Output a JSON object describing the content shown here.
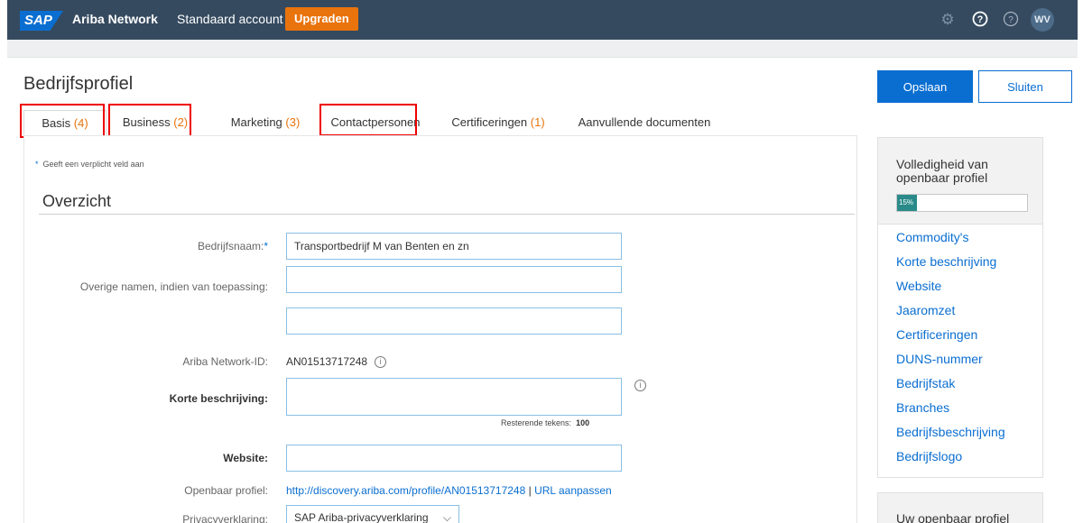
{
  "topbar": {
    "logo": "SAP",
    "brand": "Ariba Network",
    "account": "Standaard account",
    "upgrade_label": "Upgraden",
    "avatar_initials": "WV",
    "icons": [
      "gear-icon",
      "help-icon",
      "help-outline-icon"
    ]
  },
  "page": {
    "title": "Bedrijfsprofiel",
    "save_label": "Opslaan",
    "close_label": "Sluiten"
  },
  "tabs": [
    {
      "label": "Basis",
      "count": "(4)"
    },
    {
      "label": "Business",
      "count": "(2)"
    },
    {
      "label": "Marketing",
      "count": "(3)"
    },
    {
      "label": "Contactpersonen",
      "count": ""
    },
    {
      "label": "Certificeringen",
      "count": "(1)"
    },
    {
      "label": "Aanvullende documenten",
      "count": ""
    }
  ],
  "form": {
    "required_note": "Geeft een verplicht veld aan",
    "section_title": "Overzicht",
    "company_name_label": "Bedrijfsnaam:",
    "company_name_value": "Transportbedrijf M van Benten en zn",
    "other_names_label": "Overige namen, indien van toepassing:",
    "other_names_value_1": "",
    "other_names_value_2": "",
    "network_id_label": "Ariba Network-ID:",
    "network_id_value": "AN01513717248",
    "short_desc_label": "Korte beschrijving:",
    "short_desc_value": "",
    "remaining_label": "Resterende tekens:",
    "remaining_value": "100",
    "website_label": "Website:",
    "website_value": "",
    "public_profile_label": "Openbaar profiel:",
    "public_profile_url": "http://discovery.ariba.com/profile/AN01513717248",
    "public_profile_separator": "|",
    "public_profile_edit": "URL aanpassen",
    "privacy_label": "Privacyverklaring:",
    "privacy_value": "SAP Ariba-privacyverklaring"
  },
  "side_panel": {
    "title": "Volledigheid van openbaar profiel",
    "progress_percent": 15,
    "progress_label": "15%",
    "links": [
      "Commodity's",
      "Korte beschrijving",
      "Website",
      "Jaaromzet",
      "Certificeringen",
      "DUNS-nummer",
      "Bedrijfstak",
      "Branches",
      "Bedrijfsbeschrijving",
      "Bedrijfslogo"
    ],
    "second_title": "Uw openbaar profiel"
  },
  "colors": {
    "topbar": "#354a5f",
    "accent": "#0a6ed1",
    "upgrade": "#e9730c",
    "highlight_box": "#ee0000",
    "progress_fill": "#2a8a8a"
  }
}
